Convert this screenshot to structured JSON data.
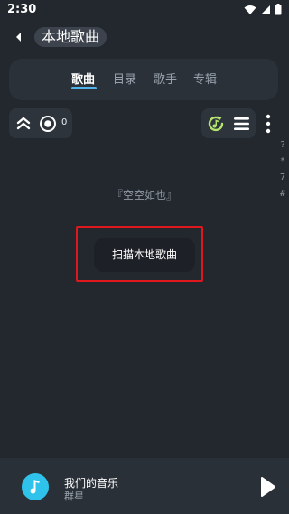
{
  "status_bar": {
    "time": "2:30",
    "icons": [
      "wifi-icon",
      "signal-icon",
      "battery-icon"
    ]
  },
  "header": {
    "back_icon": "back-arrow-icon",
    "title": "本地歌曲"
  },
  "tabs": [
    {
      "label": "歌曲",
      "active": true
    },
    {
      "label": "目录",
      "active": false
    },
    {
      "label": "歌手",
      "active": false
    },
    {
      "label": "专辑",
      "active": false
    }
  ],
  "controls": {
    "left_icons": [
      "double-chevron-up-icon",
      "target-circle-icon"
    ],
    "count": "0",
    "right_icons": [
      "refresh-music-icon",
      "list-icon"
    ],
    "more_icon": "more-vertical-icon"
  },
  "index_letters": [
    "?",
    "*",
    "7",
    "#"
  ],
  "empty_message": "『空空如也』",
  "scan_button": "扫描本地歌曲",
  "player": {
    "song_title": "我们的音乐",
    "artist": "群星",
    "cover_icon": "music-note-icon",
    "play_icon": "play-icon"
  },
  "colors": {
    "background": "#23282f",
    "accent": "#4fb3ea",
    "highlight_box": "#e0171c",
    "cover": "#2fc3ec",
    "refresh_icon": "#b6e36d"
  }
}
